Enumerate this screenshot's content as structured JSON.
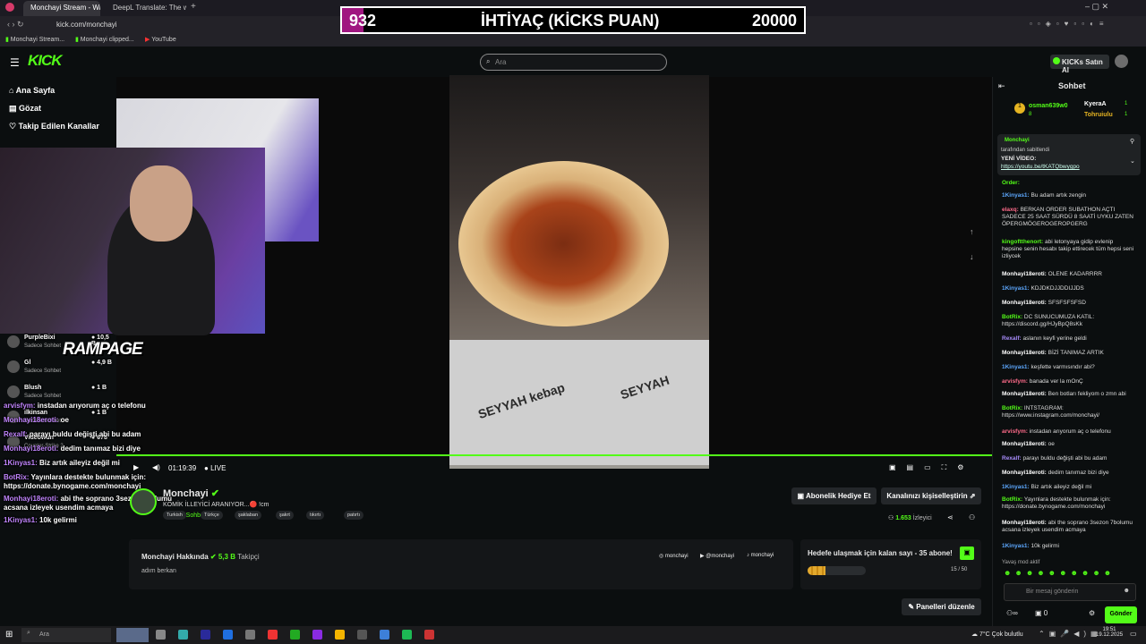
{
  "browser": {
    "tabs": [
      {
        "label": "Monchayi Stream - Watch"
      },
      {
        "label": "DeepL Translate: The wo"
      }
    ],
    "url": "kick.com/monchayi",
    "bookmarks": [
      "Monchayi Stream...",
      "Monchayi clipped...",
      "YouTube"
    ]
  },
  "overlay": {
    "left_value": "932",
    "title": "İHTİYAÇ (KİCKS PUAN)",
    "right_value": "20000",
    "fill_fraction": 0.047
  },
  "header": {
    "search_placeholder": "Ara",
    "buy_label": "KICKs Satın Al"
  },
  "sidebar": {
    "items": [
      {
        "label": "Ana Sayfa"
      },
      {
        "label": "Gözat"
      },
      {
        "label": "Takip Edilen Kanallar"
      }
    ]
  },
  "player": {
    "time": "01:19:39",
    "live": "LIVE"
  },
  "stream_overlay_chat": [
    {
      "user": "PurpleBixi",
      "sub": "Sadece Sohbet",
      "value": "10,5 B"
    },
    {
      "user": "Gl",
      "sub": "Sadece Sohbet",
      "value": "4,9 B"
    },
    {
      "user": "Blush",
      "sub": "Sadece Sohbet",
      "value": "1 B"
    },
    {
      "user": "ilkinsan",
      "sub": "Sadece Sohbet",
      "value": "1 B"
    },
    {
      "user": "Videowun",
      "sub": "Counter-Strike 2",
      "value": "678"
    }
  ],
  "overlay_brand": "RAMPAGE",
  "overlay_lines": [
    {
      "user": "arvisfym:",
      "text": "instadan arıyorum aç o telefonu"
    },
    {
      "user": "Monhayi18eroti:",
      "text": "oe"
    },
    {
      "user": "Rexalf:",
      "text": "parayı buldu değişti abi bu adam"
    },
    {
      "user": "Monhayi18eroti:",
      "text": "dedim tanımaz bizi diye"
    },
    {
      "user": "1Kinyas1:",
      "text": "Biz artık aileyiz değil mi"
    },
    {
      "user": "BotRix:",
      "text": "Yayınlara destekte bulunmak için: https://donate.bynogame.com/monchayi"
    },
    {
      "user": "Monhayi18eroti:",
      "text": "abi the soprano 3sezon 7bolumu acsana izleyek usendim acmaya"
    },
    {
      "user": "1Kinyas1:",
      "text": "10k gelirmi"
    }
  ],
  "channel": {
    "name": "Monchayi",
    "title": "KOMİK İLLEYİCİ ARANIYOR...🔴 !cm",
    "mode": "Sadece Sohbet",
    "tags": [
      "Turkish",
      "Türkçe",
      "şaklaban",
      "şakrt",
      "tıkırtı",
      "patırtı"
    ],
    "subscribe_gift": "Abonelik Hediye Et",
    "customize": "Kanalınızı kişiselleştirin",
    "viewers": "1.653",
    "viewers_label": "İzleyici",
    "about_title": "Monchayi Hakkında",
    "followers": "5,3 B",
    "followers_label": "Takipçi",
    "about_text": "adım berkan",
    "socials": [
      "monchayi",
      "@monchayi",
      "monchayi"
    ],
    "goal_title": "Hedefe ulaşmak için kalan sayı - 35 abone!",
    "goal_value": "15 / 50",
    "goal_fraction": 0.3,
    "edit_panels": "Panelleri düzenle"
  },
  "chat": {
    "title": "Sohbet",
    "top": [
      {
        "user": "osman639w0",
        "value": "8"
      },
      {
        "user": "KyeraA",
        "value": "1"
      },
      {
        "user": "Tohruiulu",
        "value": "1"
      }
    ],
    "pinned": {
      "user": "Monchayi",
      "by": "tarafından sabitlendi",
      "text": "YENİ VİDEO:",
      "link": "https://youtu.be/tKATQbwygpo"
    },
    "messages": [
      {
        "user": "Order:",
        "text": "",
        "c": "g"
      },
      {
        "user": "1Kinyas1:",
        "text": "Bu adam artık zengin",
        "c": "bl"
      },
      {
        "user": "elaxq:",
        "text": "BERKAN ORDER SUBATHON AÇTI SADECE 25 SAAT SÜRDÜ 8 SAATİ UYKU ZATEN ÖPERGMÖGEROGEROPGERG",
        "c": "pk"
      },
      {
        "user": "kingoftthenort:",
        "text": "abi letonyaya gidip evlenip hepsine senin hesabı takip ettirecek tüm hepsi seni izliycek",
        "c": "g"
      },
      {
        "user": "Monhayi18eroti:",
        "text": "OLENE KADARRRR",
        "c": "w"
      },
      {
        "user": "1Kinyas1:",
        "text": "KDJDKDJJDDIJJDS",
        "c": "bl"
      },
      {
        "user": "Monhayi18eroti:",
        "text": "SFSFSFSFSD",
        "c": "w"
      },
      {
        "user": "BotRix:",
        "text": "DC SUNUCUMUZA KATIL: https://discord.gg/HJyBpQ8sKk",
        "c": "g"
      },
      {
        "user": "Rexalf:",
        "text": "aslanın keyfi yerine geldi",
        "c": "gm"
      },
      {
        "user": "Monhayi18eroti:",
        "text": "BİZİ TANIMAZ ARTIK",
        "c": "w"
      },
      {
        "user": "1Kinyas1:",
        "text": "keşfette varmısındır abi?",
        "c": "bl"
      },
      {
        "user": "arvisfym:",
        "text": "banada ver la mOnÇ",
        "c": "pk"
      },
      {
        "user": "Monhayi18eroti:",
        "text": "Ben botları fekliyom o zmn abi",
        "c": "w"
      },
      {
        "user": "BotRix:",
        "text": "INTSTAGRAM: https://www.instagram.com/monchayi/",
        "c": "g"
      },
      {
        "user": "arvisfym:",
        "text": "instadan arıyorum aç o telefonu",
        "c": "pk"
      },
      {
        "user": "Monhayi18eroti:",
        "text": "oe",
        "c": "w"
      },
      {
        "user": "Rexalf:",
        "text": "parayı buldu değişti abi bu adam",
        "c": "gm"
      },
      {
        "user": "Monhayi18eroti:",
        "text": "dedim tanımaz bizi diye",
        "c": "w"
      },
      {
        "user": "1Kinyas1:",
        "text": "Biz artık aileyiz değil mi",
        "c": "bl"
      },
      {
        "user": "BotRix:",
        "text": "Yayınlara destekte bulunmak için: https://donate.bynogame.com/monchayi",
        "c": "g"
      },
      {
        "user": "Monhayi18eroti:",
        "text": "abi the soprano 3sezon 7bolumu acsana izleyek usendim acmaya",
        "c": "w"
      },
      {
        "user": "1Kinyas1:",
        "text": "10k gelirmi",
        "c": "bl"
      }
    ],
    "slow_mode": "Yavaş mod aktif",
    "input_placeholder": "Bir mesaj gönderin",
    "points": "0",
    "send": "Gönder"
  },
  "taskbar": {
    "search": "Ara",
    "weather": "7°C  Çok bulutlu",
    "time": "19:51",
    "date": "19.12.2025"
  }
}
